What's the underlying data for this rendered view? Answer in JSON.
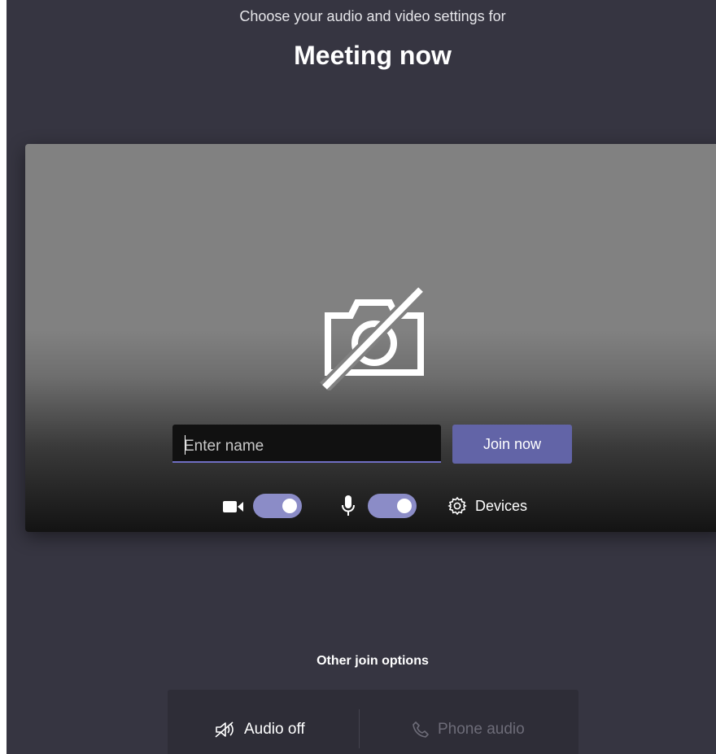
{
  "header": {
    "subtitle": "Choose your audio and video settings for",
    "title": "Meeting now"
  },
  "preview": {
    "icon": "camera-off-icon",
    "name_placeholder": "Enter name",
    "name_value": "",
    "join_label": "Join now"
  },
  "controls": {
    "video_icon": "video-camera-icon",
    "video_on": true,
    "mic_icon": "microphone-icon",
    "mic_on": true,
    "devices_icon": "gear-icon",
    "devices_label": "Devices"
  },
  "other_options": {
    "title": "Other join options",
    "audio_off_label": "Audio off",
    "audio_off_icon": "speaker-off-icon",
    "phone_audio_label": "Phone audio",
    "phone_audio_icon": "phone-icon",
    "phone_audio_enabled": false
  },
  "colors": {
    "background": "#363541",
    "accent": "#6264a7",
    "toggle_on": "#8b8cc7",
    "options_bar": "#2e2d37"
  }
}
